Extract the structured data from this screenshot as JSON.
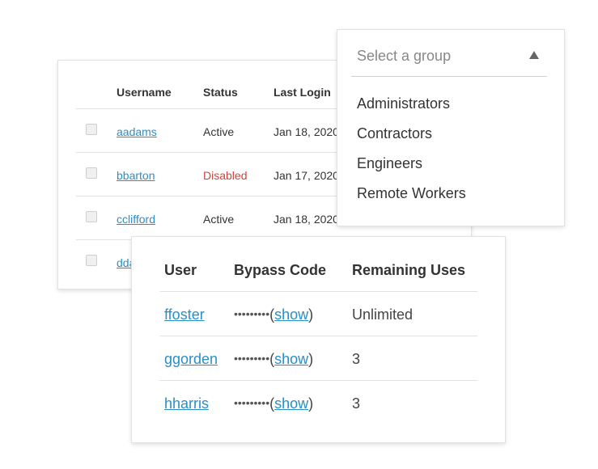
{
  "users_table": {
    "columns": [
      "Username",
      "Status",
      "Last Login"
    ],
    "rows": [
      {
        "username": "aadams",
        "status": "Active",
        "last_login": "Jan 18, 2020"
      },
      {
        "username": "bbarton",
        "status": "Disabled",
        "last_login": "Jan 17, 2020"
      },
      {
        "username": "cclifford",
        "status": "Active",
        "last_login": "Jan 18, 2020"
      },
      {
        "username": "dda",
        "status": "",
        "last_login": ""
      }
    ],
    "colors": {
      "link": "#2a8ec8",
      "disabled": "#d0433a"
    }
  },
  "group_select": {
    "placeholder": "Select a group",
    "options": [
      "Administrators",
      "Contractors",
      "Engineers",
      "Remote Workers"
    ]
  },
  "bypass_codes": {
    "columns": [
      "User",
      "Bypass Code",
      "Remaining Uses"
    ],
    "rows": [
      {
        "user": "ffoster",
        "mask": "•••••••••",
        "show_label": "show",
        "remaining": "Unlimited"
      },
      {
        "user": "ggorden",
        "mask": "•••••••••",
        "show_label": "show",
        "remaining": "3"
      },
      {
        "user": "hharris",
        "mask": "•••••••••",
        "show_label": "show",
        "remaining": "3"
      }
    ]
  },
  "paren_open": "(",
  "paren_close": ")"
}
